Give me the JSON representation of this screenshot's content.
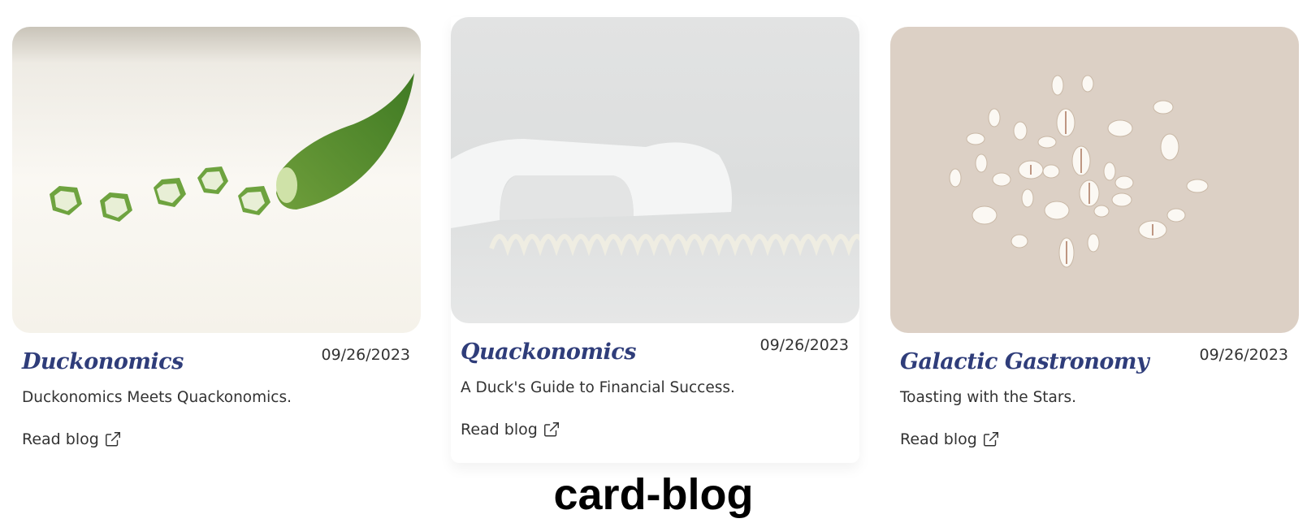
{
  "cards": [
    {
      "title": "Duckonomics",
      "date": "09/26/2023",
      "description": "Duckonomics Meets Quackonomics.",
      "link_label": "Read blog",
      "image_icon": "okra-image",
      "link_icon": "external-link-icon"
    },
    {
      "title": "Quackonomics",
      "date": "09/26/2023",
      "description": "A Duck's Guide to Financial Success.",
      "link_label": "Read blog",
      "image_icon": "telephone-image",
      "link_icon": "external-link-icon"
    },
    {
      "title": "Galactic Gastronomy",
      "date": "09/26/2023",
      "description": "Toasting with the Stars.",
      "link_label": "Read blog",
      "image_icon": "cowrie-shells-image",
      "link_icon": "external-link-icon"
    }
  ],
  "caption": "card-blog",
  "colors": {
    "title": "#2f3d7a",
    "text": "#333333",
    "background": "#ffffff"
  }
}
